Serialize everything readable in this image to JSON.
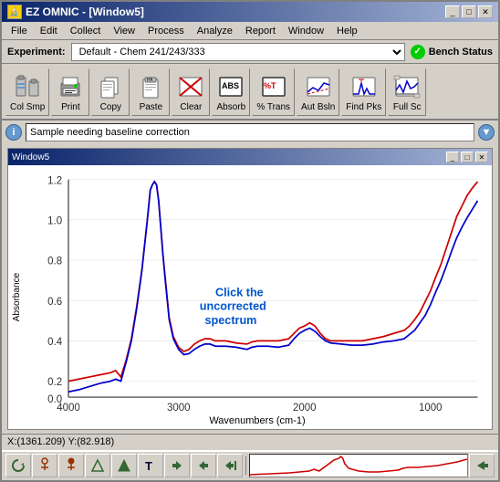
{
  "window": {
    "title": "EZ OMNIC - [Window5]",
    "inner_title": "Window5"
  },
  "menu": {
    "items": [
      "File",
      "Edit",
      "Collect",
      "View",
      "Process",
      "Analyze",
      "Report",
      "Window",
      "Help"
    ]
  },
  "experiment": {
    "label": "Experiment:",
    "value": "Default - Chem 241/243/333",
    "bench_status": "Bench Status"
  },
  "toolbar": {
    "buttons": [
      {
        "id": "col-smp",
        "label": "Col Smp"
      },
      {
        "id": "print",
        "label": "Print"
      },
      {
        "id": "copy",
        "label": "Copy"
      },
      {
        "id": "paste",
        "label": "Paste"
      },
      {
        "id": "clear",
        "label": "Clear"
      },
      {
        "id": "absorb",
        "label": "Absorb"
      },
      {
        "id": "pct-trans",
        "label": "% Trans"
      },
      {
        "id": "aut-bsln",
        "label": "Aut Bsln"
      },
      {
        "id": "find-pks",
        "label": "Find Pks"
      },
      {
        "id": "full-sc",
        "label": "Full Sc"
      }
    ]
  },
  "info_bar": {
    "text": "Sample needing baseline correction"
  },
  "chart": {
    "y_axis_label": "Absorbance",
    "x_axis_label": "Wavenumbers (cm-1)",
    "y_max": 1.2,
    "y_ticks": [
      "1.2",
      "1.0",
      "0.8",
      "0.6",
      "0.4",
      "0.2",
      "0.0"
    ],
    "x_ticks": [
      "4000",
      "3000",
      "2000",
      "1000"
    ],
    "annotation": "Click the\nuncorrected\nspectrum"
  },
  "coords": {
    "text": "X:(1361.209)  Y:(82.918)"
  },
  "bottom_toolbar": {
    "buttons": [
      "rotate-icon",
      "anchor-icon",
      "anchor2-icon",
      "triangle-icon",
      "triangle2-icon",
      "text-icon",
      "left-arrow-icon",
      "right-arrow-icon",
      "end-icon"
    ],
    "right_arrow": "arrow-right-icon"
  }
}
